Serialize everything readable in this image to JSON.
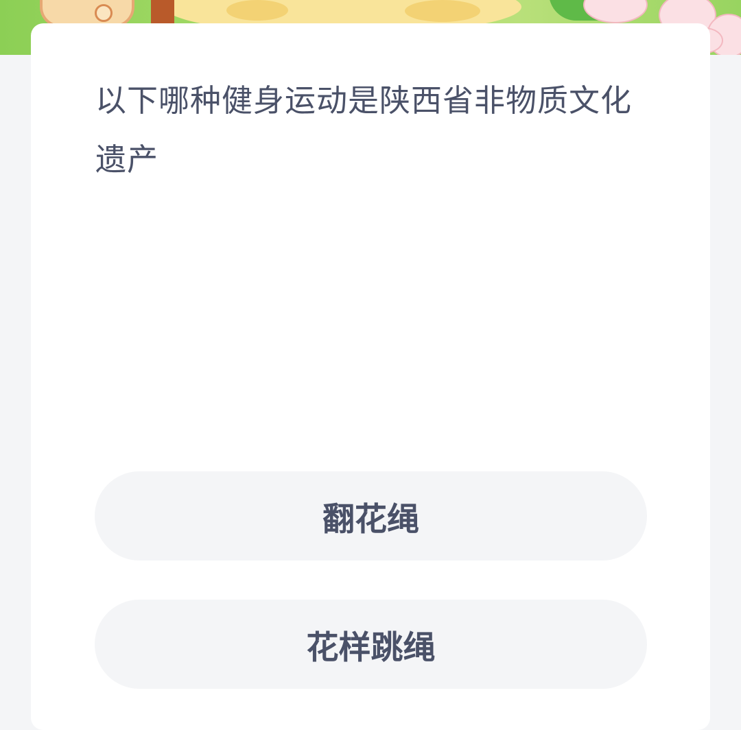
{
  "banner": {
    "icon": "cartoon-illustration"
  },
  "quiz": {
    "question": "以下哪种健身运动是陕西省非物质文化遗产",
    "options": [
      {
        "label": "翻花绳"
      },
      {
        "label": "花样跳绳"
      }
    ]
  },
  "colors": {
    "background": "#f4f5f7",
    "card": "#ffffff",
    "text": "#4a5168",
    "option_bg": "#f4f5f7",
    "banner_green": "#8ccf55"
  }
}
